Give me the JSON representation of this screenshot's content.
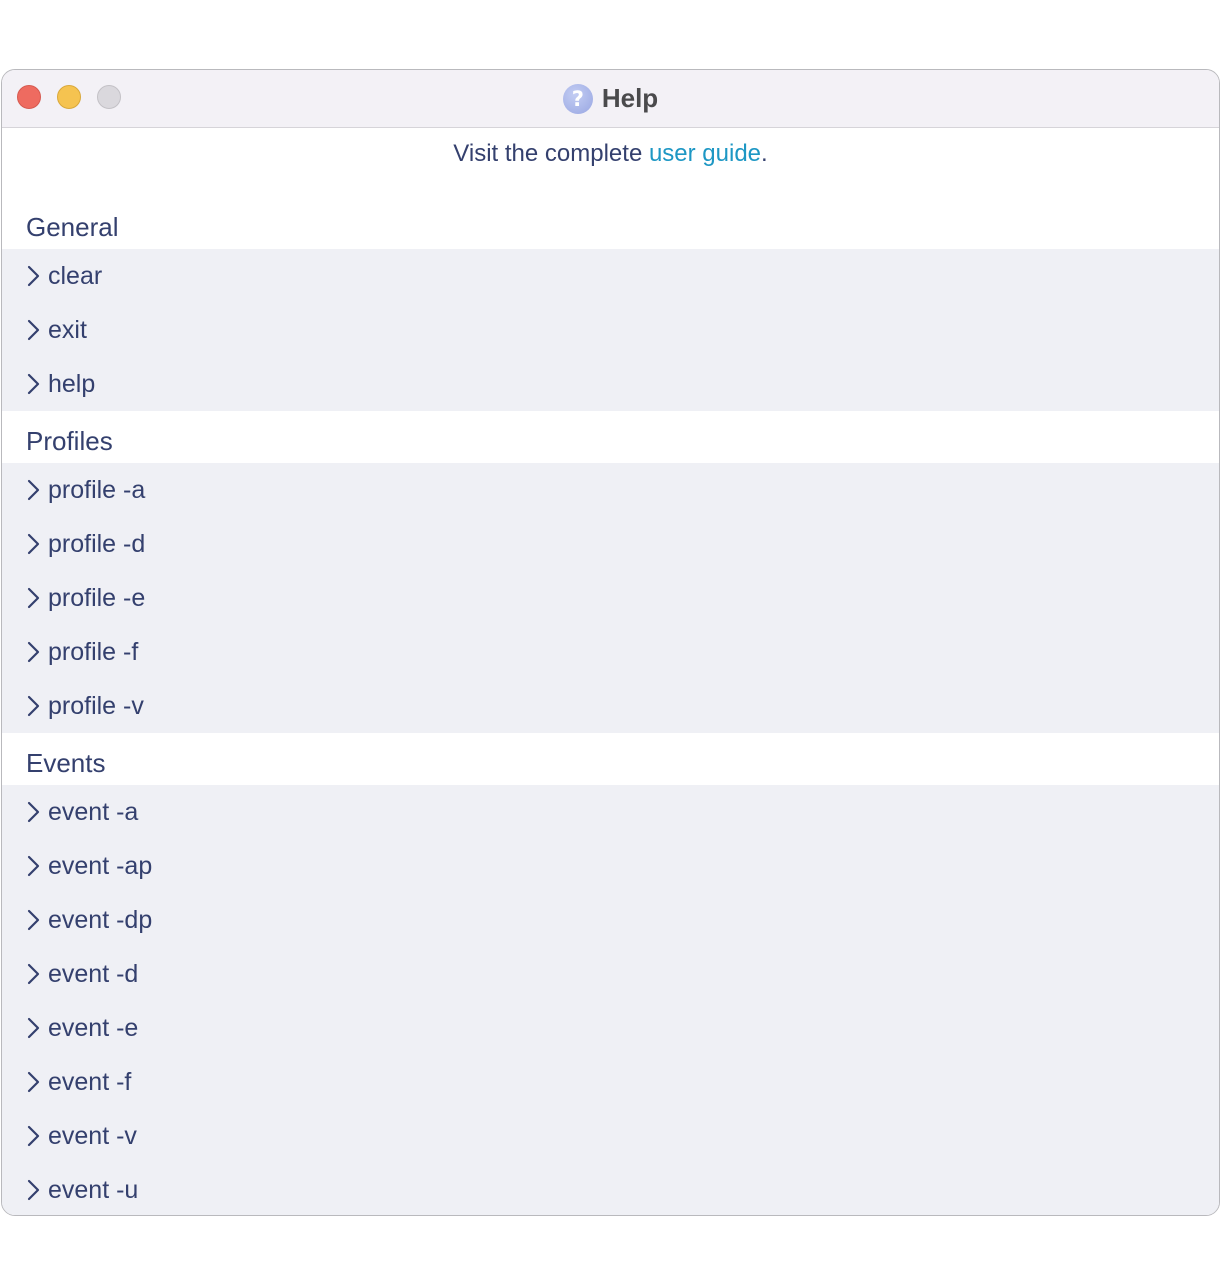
{
  "window": {
    "title": "Help",
    "title_icon": "question-circle-icon"
  },
  "intro": {
    "prefix": "Visit the complete ",
    "link_label": "user guide",
    "suffix": "."
  },
  "sections": [
    {
      "heading": "General",
      "items": [
        "clear",
        "exit",
        "help"
      ]
    },
    {
      "heading": "Profiles",
      "items": [
        "profile -a",
        "profile -d",
        "profile -e",
        "profile -f",
        "profile -v"
      ]
    },
    {
      "heading": "Events",
      "items": [
        "event -a",
        "event -ap",
        "event -dp",
        "event -d",
        "event -e",
        "event -f",
        "event -v",
        "event -u"
      ]
    }
  ],
  "colors": {
    "text": "#34406e",
    "link": "#1d97c4",
    "row_background": "#eff0f5",
    "titlebar": "#f3f1f6"
  }
}
